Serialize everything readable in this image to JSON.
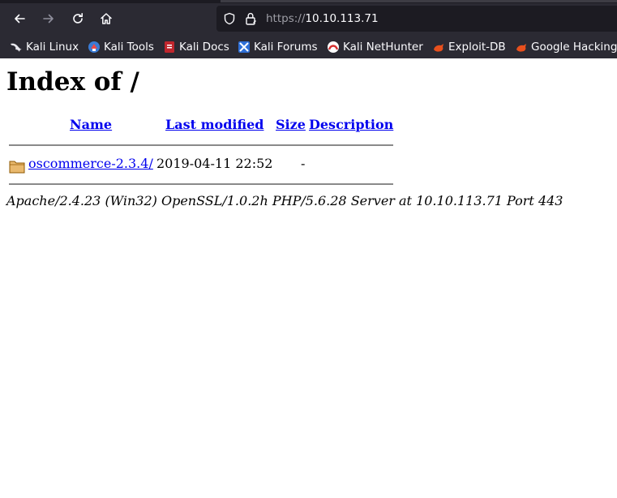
{
  "browser": {
    "url": {
      "scheme": "https://",
      "host": "10.10.113.71"
    },
    "bookmarks": [
      {
        "label": "Kali Linux",
        "icon": "kali-dragon-icon"
      },
      {
        "label": "Kali Tools",
        "icon": "kali-tools-icon"
      },
      {
        "label": "Kali Docs",
        "icon": "kali-docs-icon"
      },
      {
        "label": "Kali Forums",
        "icon": "kali-forums-icon"
      },
      {
        "label": "Kali NetHunter",
        "icon": "kali-nethunter-icon"
      },
      {
        "label": "Exploit-DB",
        "icon": "exploit-db-icon"
      },
      {
        "label": "Google Hacking",
        "icon": "google-hacking-icon"
      }
    ],
    "colors": {
      "toolbar": "#2b2a33",
      "urlbar": "#1c1b22",
      "text": "#fbfbfe"
    }
  },
  "page": {
    "title": "Index of /",
    "columns": {
      "name": "Name",
      "last_modified": "Last modified",
      "size": "Size",
      "description": "Description"
    },
    "entries": [
      {
        "icon": "folder-icon",
        "name": "oscommerce-2.3.4/",
        "last_modified": "2019-04-11 22:52",
        "size": "-",
        "description": ""
      }
    ],
    "footer": "Apache/2.4.23 (Win32) OpenSSL/1.0.2h PHP/5.6.28 Server at 10.10.113.71 Port 443",
    "colors": {
      "link": "#0000ee",
      "rule": "#8a8a8a"
    }
  }
}
